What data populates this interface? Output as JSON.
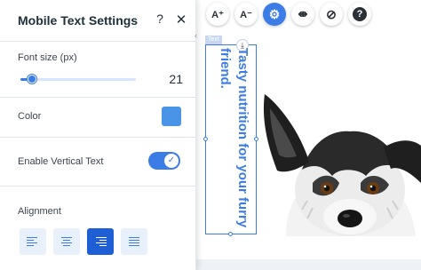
{
  "panel": {
    "title": "Mobile Text Settings",
    "help_icon": "?",
    "close_icon": "✕",
    "collapse_icon": "‹",
    "font_size": {
      "label": "Font size (px)",
      "value": "21",
      "slider_fraction": 0.1
    },
    "color": {
      "label": "Color",
      "swatch": "#4a94e8"
    },
    "vertical_text": {
      "label": "Enable Vertical Text",
      "enabled": true,
      "check_icon": "✓"
    },
    "alignment": {
      "label": "Alignment",
      "options": [
        "align-left",
        "align-center",
        "align-right",
        "justify"
      ],
      "selected": "align-right"
    }
  },
  "toolbar": {
    "buttons": [
      {
        "name": "increase-font-size-button",
        "icon": "font-increase-icon",
        "glyph": "A⁺"
      },
      {
        "name": "decrease-font-size-button",
        "icon": "font-decrease-icon",
        "glyph": "A⁻"
      },
      {
        "name": "settings-button",
        "icon": "gear-icon",
        "glyph": "⚙",
        "active": true
      },
      {
        "name": "arrange-button",
        "icon": "arrange-arrows-icon",
        "glyph": "⇼"
      },
      {
        "name": "hide-button",
        "icon": "eye-slash-icon",
        "glyph": "⊘"
      },
      {
        "name": "help-button",
        "icon": "help-icon",
        "glyph": "?"
      }
    ]
  },
  "canvas": {
    "element_tag": "Text",
    "anchor_icon": "⤓",
    "vertical_text": "Tasty nutrition for your furry friend.",
    "accent": "#3b7ce6"
  }
}
